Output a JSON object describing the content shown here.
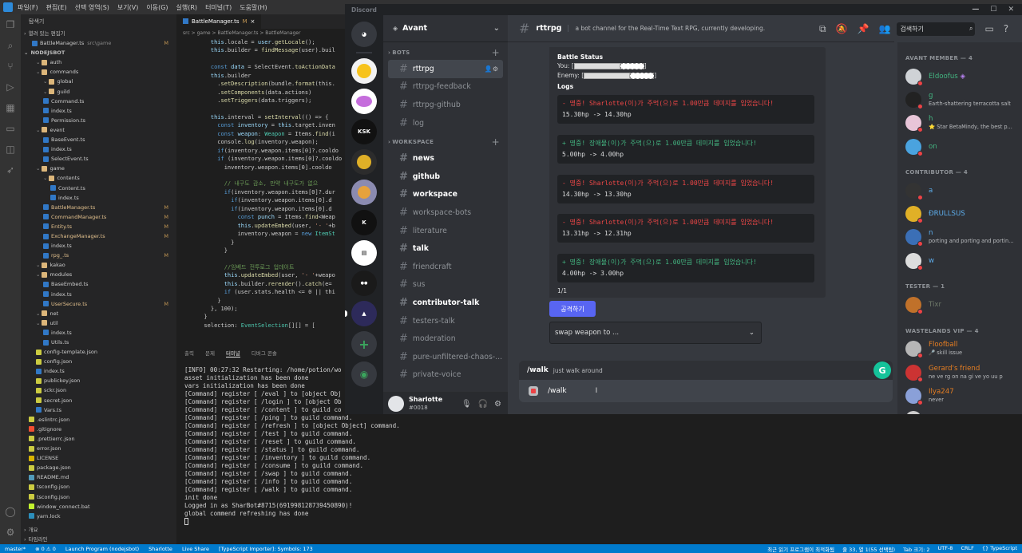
{
  "vscode": {
    "menu": [
      "파일(F)",
      "편집(E)",
      "선택 영역(S)",
      "보기(V)",
      "이동(G)",
      "실행(R)",
      "터미널(T)",
      "도움말(H)"
    ],
    "explorer_title": "탐색기",
    "open_editors_label": "열려 있는 편집기",
    "open_file": "BattleManager.ts",
    "open_file_path": "src\\game",
    "project": "NODEJSBOT",
    "tree": [
      {
        "name": "auth",
        "indent": 1,
        "type": "folder"
      },
      {
        "name": "commands",
        "indent": 1,
        "type": "folder"
      },
      {
        "name": "global",
        "indent": 2,
        "type": "folder"
      },
      {
        "name": "guild",
        "indent": 2,
        "type": "folder"
      },
      {
        "name": "Command.ts",
        "indent": 2,
        "type": "ts"
      },
      {
        "name": "index.ts",
        "indent": 2,
        "type": "ts"
      },
      {
        "name": "Permission.ts",
        "indent": 2,
        "type": "ts"
      },
      {
        "name": "event",
        "indent": 1,
        "type": "folder"
      },
      {
        "name": "BaseEvent.ts",
        "indent": 2,
        "type": "ts"
      },
      {
        "name": "index.ts",
        "indent": 2,
        "type": "ts"
      },
      {
        "name": "SelectEvent.ts",
        "indent": 2,
        "type": "ts"
      },
      {
        "name": "game",
        "indent": 1,
        "type": "folder"
      },
      {
        "name": "contents",
        "indent": 2,
        "type": "folder"
      },
      {
        "name": "Content.ts",
        "indent": 3,
        "type": "ts"
      },
      {
        "name": "index.ts",
        "indent": 3,
        "type": "ts"
      },
      {
        "name": "BattleManager.ts",
        "indent": 2,
        "type": "ts",
        "m": "M"
      },
      {
        "name": "CommandManager.ts",
        "indent": 2,
        "type": "ts",
        "m": "M"
      },
      {
        "name": "Entity.ts",
        "indent": 2,
        "type": "ts",
        "m": "M"
      },
      {
        "name": "ExchangeManager.ts",
        "indent": 2,
        "type": "ts",
        "m": "M"
      },
      {
        "name": "index.ts",
        "indent": 2,
        "type": "ts"
      },
      {
        "name": "rpg_.ts",
        "indent": 2,
        "type": "ts",
        "m": "M"
      },
      {
        "name": "kakao",
        "indent": 1,
        "type": "folder"
      },
      {
        "name": "modules",
        "indent": 1,
        "type": "folder"
      },
      {
        "name": "BaseEmbed.ts",
        "indent": 2,
        "type": "ts"
      },
      {
        "name": "index.ts",
        "indent": 2,
        "type": "ts"
      },
      {
        "name": "UserSecure.ts",
        "indent": 2,
        "type": "ts",
        "m": "M"
      },
      {
        "name": "net",
        "indent": 1,
        "type": "folder"
      },
      {
        "name": "util",
        "indent": 1,
        "type": "folder"
      },
      {
        "name": "index.ts",
        "indent": 2,
        "type": "ts"
      },
      {
        "name": "Utils.ts",
        "indent": 2,
        "type": "ts"
      },
      {
        "name": "config-template.json",
        "indent": 1,
        "type": "json"
      },
      {
        "name": "config.json",
        "indent": 1,
        "type": "json"
      },
      {
        "name": "index.ts",
        "indent": 1,
        "type": "ts"
      },
      {
        "name": "publickey.json",
        "indent": 1,
        "type": "json"
      },
      {
        "name": "sckr.json",
        "indent": 1,
        "type": "json"
      },
      {
        "name": "secret.json",
        "indent": 1,
        "type": "json"
      },
      {
        "name": "Vars.ts",
        "indent": 1,
        "type": "ts"
      },
      {
        "name": ".eslintrc.json",
        "indent": 0,
        "type": "json"
      },
      {
        "name": ".gitignore",
        "indent": 0,
        "type": "git"
      },
      {
        "name": ".prettierrc.json",
        "indent": 0,
        "type": "json"
      },
      {
        "name": "error.json",
        "indent": 0,
        "type": "json"
      },
      {
        "name": "LICENSE",
        "indent": 0,
        "type": "lic"
      },
      {
        "name": "package.json",
        "indent": 0,
        "type": "json"
      },
      {
        "name": "README.md",
        "indent": 0,
        "type": "md"
      },
      {
        "name": "tsconfig.json",
        "indent": 0,
        "type": "json"
      },
      {
        "name": "tsconfig.json",
        "indent": 0,
        "type": "json"
      },
      {
        "name": "window_connect.bat",
        "indent": 0,
        "type": "bat"
      },
      {
        "name": "yarn.lock",
        "indent": 0,
        "type": "lock"
      }
    ],
    "outline_label": "개요",
    "timeline_label": "타임라인",
    "editor_tab": "BattleManager.ts",
    "editor_tab_m": "M",
    "breadcrumb": "src > game > BattleManager.ts > BattleManager",
    "code_lines": [
      {
        "n": "",
        "html": "    <span class='v'>this</span>.locale = <span class='v'>user</span>.<span class='f'>getLocale</span>();"
      },
      {
        "n": "",
        "html": "    <span class='v'>this</span>.builder = <span class='f'>findMessage</span>(user).buil"
      },
      {
        "n": "",
        "html": ""
      },
      {
        "n": "",
        "html": "    <span class='k'>const</span> <span class='v'>data</span> = SelectEvent.<span class='f'>toActionData</span>"
      },
      {
        "n": "",
        "html": "    <span class='v'>this</span>.builder"
      },
      {
        "n": "",
        "html": "      .<span class='f'>setDescription</span>(bundle.<span class='f'>format</span>(this."
      },
      {
        "n": "",
        "html": "      .<span class='f'>setComponents</span>(data.actions)"
      },
      {
        "n": "",
        "html": "      .<span class='f'>setTriggers</span>(data.triggers);"
      },
      {
        "n": "",
        "html": ""
      },
      {
        "n": "",
        "html": "    <span class='v'>this</span>.interval = <span class='f'>setInterval</span>(() => {"
      },
      {
        "n": "",
        "html": "      <span class='k'>const</span> <span class='v'>inventory</span> = <span class='v'>this</span>.target.inven"
      },
      {
        "n": "",
        "html": "      <span class='k'>const</span> <span class='v'>weapon</span>: <span class='t'>Weapon</span> = Items.<span class='f'>find</span>(i"
      },
      {
        "n": "",
        "html": "      console.<span class='f'>log</span>(inventory.weapon);"
      },
      {
        "n": "",
        "html": "      <span class='k'>if</span>(inventory.weapon.items[0]?.cooldo"
      },
      {
        "n": "",
        "html": "      <span class='k'>if</span> (inventory.weapon.items[0]?.cooldo"
      },
      {
        "n": "",
        "html": "        inventory.weapon.items[0].cooldo"
      },
      {
        "n": "",
        "html": ""
      },
      {
        "n": "",
        "html": "        <span class='c'>// 내구도 감소, 만약 내구도가 없으</span>"
      },
      {
        "n": "",
        "html": "        <span class='k'>if</span>(inventory.weapon.items[0]?.dur"
      },
      {
        "n": "",
        "html": "          <span class='k'>if</span>(inventory.weapon.items[0].d"
      },
      {
        "n": "",
        "html": "          <span class='k'>if</span>(inventory.weapon.items[0].d"
      },
      {
        "n": "",
        "html": "            <span class='k'>const</span> <span class='v'>punch</span> = Items.<span class='f'>find</span>&lt;Weap"
      },
      {
        "n": "",
        "html": "            <span class='v'>this</span>.<span class='f'>updateEmbed</span>(user, <span class='s'>'- '</span>+b"
      },
      {
        "n": "",
        "html": "            inventory.weapon = <span class='k'>new</span> <span class='t'>ItemSt</span>"
      },
      {
        "n": "",
        "html": "          }"
      },
      {
        "n": "",
        "html": "        }"
      },
      {
        "n": "",
        "html": ""
      },
      {
        "n": "",
        "html": "        <span class='c'>//임베드 전투로그 업데이트</span>"
      },
      {
        "n": "",
        "html": "        <span class='v'>this</span>.<span class='f'>updateEmbed</span>(user, <span class='s'>'- '</span>+weapo"
      },
      {
        "n": "",
        "html": "        <span class='v'>this</span>.builder.<span class='f'>rerender</span>().<span class='f'>catch</span>(e="
      },
      {
        "n": "",
        "html": "        <span class='k'>if</span> (user.stats.health &lt;= 0 || thi"
      },
      {
        "n": "",
        "html": "      }"
      },
      {
        "n": "",
        "html": "    }, 100);"
      },
      {
        "n": "",
        "html": "  }"
      },
      {
        "n": "",
        "html": "  selection: <span class='t'>EventSelection</span>[][] = ["
      }
    ],
    "terminal_tabs": [
      "출력",
      "문제",
      "터미널",
      "디버그 콘솔"
    ],
    "terminal_active": "터미널",
    "terminal_lines": [
      "[INFO] 00:27:32 Restarting: /home/potion/wo",
      "asset initialization has been done",
      "vars initialization has been done",
      "[Command] register [ /eval ] to [object Obj",
      "[Command] register [ /login ] to [object Ob",
      "[Command] register [ /content ] to guild co",
      "[Command] register [ /ping ] to guild command.",
      "[Command] register [ /refresh ] to [object Object] command.",
      "[Command] register [ /test ] to guild command.",
      "[Command] register [ /reset ] to guild command.",
      "[Command] register [ /status ] to guild command.",
      "[Command] register [ /inventory ] to guild command.",
      "[Command] register [ /consume ] to guild command.",
      "[Command] register [ /swap ] to guild command.",
      "[Command] register [ /info ] to guild command.",
      "[Command] register [ /walk ] to guild command.",
      "init done",
      "Logged in as SharBot#8715(691998128739450890)!",
      "global commend refreshing has done"
    ],
    "status_left": [
      "master*",
      "⊗ 0 ⚠ 0",
      "Launch Program (nodejsbot)",
      "Sharlotte",
      "Live Share",
      "[TypeScript Importer]: Symbols: 173"
    ],
    "status_right": [
      "최근 읽기 프로그램이 최적화됨",
      "줄 33, 열 1(55 선택됨)",
      "Tab 크기: 2",
      "UTF-8",
      "CRLF",
      "{} TypeScript"
    ]
  },
  "discord": {
    "app_title": "Discord",
    "server_name": "Avant",
    "categories": {
      "bots": "BOTS",
      "workspace": "WORKSPACE"
    },
    "bot_channels": [
      {
        "name": "rttrpg",
        "selected": true,
        "unread": false
      },
      {
        "name": "rttrpg-feedback",
        "selected": false,
        "unread": false
      },
      {
        "name": "rttrpg-github",
        "selected": false,
        "unread": false
      },
      {
        "name": "log",
        "selected": false,
        "unread": false
      }
    ],
    "workspace_channels": [
      {
        "name": "news",
        "unread": true
      },
      {
        "name": "github",
        "unread": true
      },
      {
        "name": "workspace",
        "unread": true
      },
      {
        "name": "workspace-bots",
        "unread": false
      },
      {
        "name": "literature",
        "unread": false
      },
      {
        "name": "talk",
        "unread": true
      },
      {
        "name": "friendcraft",
        "unread": false
      },
      {
        "name": "sus",
        "unread": false
      },
      {
        "name": "contributor-talk",
        "unread": true
      },
      {
        "name": "testers-talk",
        "unread": false
      },
      {
        "name": "moderation",
        "unread": false
      },
      {
        "name": "pure-unfiltered-chaos-...",
        "unread": false
      },
      {
        "name": "private-voice",
        "unread": false
      }
    ],
    "user": {
      "name": "Sharlotte",
      "tag": "#0018"
    },
    "channel": {
      "name": "rttrpg",
      "topic": "a bot channel for the Real-Time Text RPG, currently developing."
    },
    "search_placeholder": "검색하기",
    "embed": {
      "title": "Battle Status",
      "you_label": "You:",
      "enemy_label": "Enemy:",
      "logs_label": "Logs",
      "logs": [
        {
          "sign": "-",
          "text": "명중! Sharlotte(이)가 주먹(으)로 1.00만큼 데미지를 입었습니다!",
          "hp": "15.30hp -> 14.30hp",
          "color": "#f04747"
        },
        {
          "sign": "+",
          "text": "명중! 장애물(이)가 주먹(으)로 1.00만큼 데미지를 입었습니다!",
          "hp": "5.00hp -> 4.00hp",
          "color": "#43b581"
        },
        {
          "sign": "-",
          "text": "명중! Sharlotte(이)가 주먹(으)로 1.00만큼 데미지를 입었습니다!",
          "hp": "14.30hp -> 13.30hp",
          "color": "#f04747"
        },
        {
          "sign": "-",
          "text": "명중! Sharlotte(이)가 주먹(으)로 1.00만큼 데미지를 입었습니다!",
          "hp": "13.31hp -> 12.31hp",
          "color": "#f04747"
        },
        {
          "sign": "+",
          "text": "명중! 장애물(이)가 주먹(으)로 1.00만큼 데미지를 입었습니다!",
          "hp": "4.00hp -> 3.00hp",
          "color": "#43b581"
        }
      ],
      "page": "1/1"
    },
    "attack_button": "공격하기",
    "weapon_select": "swap weapon to ...",
    "autocomplete": {
      "command": "/walk",
      "description": "just walk around"
    },
    "input_value": "/walk",
    "member_groups": [
      {
        "label": "AVANT MEMBER — 4",
        "members": [
          {
            "name": "Eldoofus",
            "sub": "",
            "color": "#43b581",
            "badge": "◈"
          },
          {
            "name": "g",
            "sub": "Earth-shattering terracotta salt",
            "color": "#43b581"
          },
          {
            "name": "h",
            "sub": "⭐ Star BetaMindy, the best p...",
            "color": "#43b581"
          },
          {
            "name": "on",
            "sub": "",
            "color": "#43b581"
          }
        ]
      },
      {
        "label": "CONTRIBUTOR — 4",
        "members": [
          {
            "name": "a",
            "sub": "",
            "color": "#5dadec"
          },
          {
            "name": "ÐRÜĹĹSÜS",
            "sub": "",
            "color": "#5dadec"
          },
          {
            "name": "n",
            "sub": "porting and porting and portin...",
            "color": "#5dadec"
          },
          {
            "name": "w",
            "sub": "",
            "color": "#5dadec"
          }
        ]
      },
      {
        "label": "TESTER — 1",
        "members": [
          {
            "name": "Tixr",
            "sub": "",
            "color": "#6f7a6a"
          }
        ]
      },
      {
        "label": "WASTELANDS VIP — 4",
        "members": [
          {
            "name": "Floofball",
            "sub": "🎤 skill issue",
            "color": "#e67e22"
          },
          {
            "name": "Gerard's friend",
            "sub": "ne ve rg on na gi ve yo uu p",
            "color": "#e67e22"
          },
          {
            "name": "Ilya247",
            "sub": "never",
            "color": "#e67e22"
          },
          {
            "name": "",
            "sub": "",
            "color": "#e67e22"
          }
        ]
      }
    ]
  }
}
